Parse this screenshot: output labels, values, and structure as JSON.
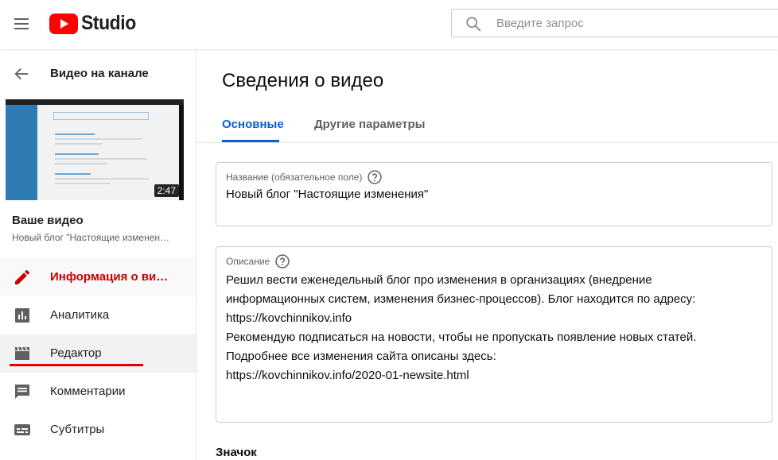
{
  "header": {
    "logo_text": "Studio",
    "search_placeholder": "Введите запрос",
    "brand_color": "#ff0000"
  },
  "sidebar": {
    "back_label": "Видео на канале",
    "video_duration": "2:47",
    "your_video_label": "Ваше видео",
    "video_title_truncated": "Новый блог \"Настоящие изменен…",
    "items": [
      {
        "label": "Информация о ви…",
        "icon": "pencil-icon",
        "active": true
      },
      {
        "label": "Аналитика",
        "icon": "analytics-icon"
      },
      {
        "label": "Редактор",
        "icon": "clapperboard-icon"
      },
      {
        "label": "Комментарии",
        "icon": "comment-icon"
      },
      {
        "label": "Субтитры",
        "icon": "subtitles-icon"
      }
    ]
  },
  "main": {
    "page_title": "Сведения о видео",
    "tabs": [
      {
        "label": "Основные",
        "active": true
      },
      {
        "label": "Другие параметры"
      }
    ],
    "title_field": {
      "label": "Название (обязательное поле)",
      "value": "Новый блог \"Настоящие изменения\""
    },
    "description_field": {
      "label": "Описание",
      "lines": [
        "Решил вести еженедельный блог про изменения в организациях (внедрение",
        "информационных систем, изменения бизнес-процессов). Блог находится по адресу:",
        "https://kovchinnikov.info",
        "Рекомендую подписаться на новости, чтобы не пропускать появление новых статей.",
        "Подробнее все изменения сайта описаны здесь:",
        "https://kovchinnikov.info/2020-01-newsite.html"
      ]
    },
    "icon_section_heading": "Значок"
  }
}
